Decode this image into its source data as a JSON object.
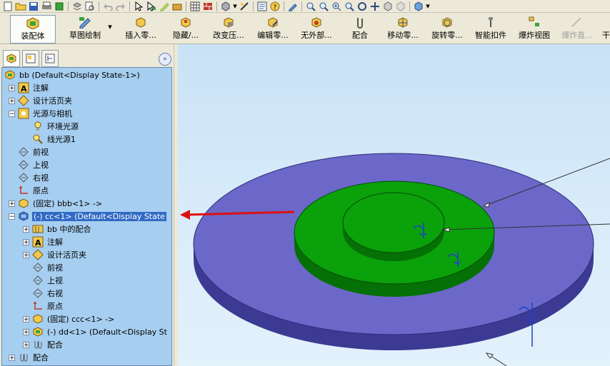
{
  "command_manager": {
    "buttons": [
      {
        "label": "装配体"
      },
      {
        "label": "草图绘制"
      },
      {
        "label": "插入零..."
      },
      {
        "label": "隐藏/..."
      },
      {
        "label": "改变压..."
      },
      {
        "label": "编辑零..."
      },
      {
        "label": "无外部..."
      },
      {
        "label": "配合"
      },
      {
        "label": "移动零..."
      },
      {
        "label": "旋转零..."
      },
      {
        "label": "智能扣件"
      },
      {
        "label": "爆炸视图"
      },
      {
        "label": "爆炸直..."
      },
      {
        "label": "干"
      }
    ]
  },
  "tree": {
    "items": [
      {
        "label": "bb  (Default<Display State-1>)"
      },
      {
        "label": "注解"
      },
      {
        "label": "设计活页夹"
      },
      {
        "label": "光源与相机"
      },
      {
        "label": "环境光源"
      },
      {
        "label": "线光源1"
      },
      {
        "label": "前视"
      },
      {
        "label": "上视"
      },
      {
        "label": "右视"
      },
      {
        "label": "原点"
      },
      {
        "label": "(固定) bbb<1> ->"
      },
      {
        "label": "(-) cc<1> (Default<Display State"
      },
      {
        "label": "bb 中的配合"
      },
      {
        "label": "注解"
      },
      {
        "label": "设计活页夹"
      },
      {
        "label": "前视"
      },
      {
        "label": "上视"
      },
      {
        "label": "右视"
      },
      {
        "label": "原点"
      },
      {
        "label": "(固定) ccc<1> ->"
      },
      {
        "label": "(-) dd<1> (Default<Display St"
      },
      {
        "label": "配合"
      },
      {
        "label": "配合"
      }
    ]
  },
  "colors": {
    "base_disc": "#6b68c9",
    "middle_disc": "#0aa10a",
    "selection": "#316ac5",
    "tree_background": "#a6cef0",
    "annotation_arrow": "#e01010"
  }
}
